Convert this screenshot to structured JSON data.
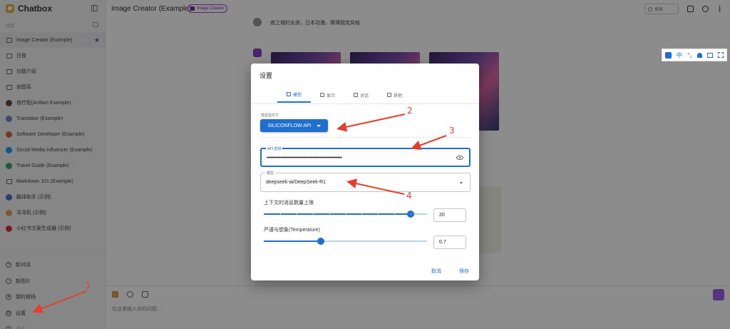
{
  "sidebar": {
    "app_name": "Chatbox",
    "section_title": "对话",
    "conversations": [
      {
        "label": "Image Creator (Example)",
        "icon": "chat-icon",
        "active": true,
        "starred": true
      },
      {
        "label": "日夜",
        "icon": "chat-icon"
      },
      {
        "label": "功能介绍",
        "icon": "chat-icon"
      },
      {
        "label": "创图系",
        "icon": "chat-icon"
      },
      {
        "label": "食疗配(Artifact Example)",
        "icon": "avatar",
        "color": "#6b4a3a"
      },
      {
        "label": "Translator (Example)",
        "icon": "avatar",
        "color": "#6f86c9"
      },
      {
        "label": "Software Developer (Example)",
        "icon": "avatar",
        "color": "#d36b3a"
      },
      {
        "label": "Social Media Influencer (Example)",
        "icon": "avatar",
        "color": "#1da1f2"
      },
      {
        "label": "Travel Guide (Example)",
        "icon": "avatar",
        "color": "#3fa06a"
      },
      {
        "label": "Markdown 101 (Example)",
        "icon": "chat-icon"
      },
      {
        "label": "翻译助手 (示例)",
        "icon": "avatar",
        "color": "#4a6fd1"
      },
      {
        "label": "寻寻机 (示例)",
        "icon": "avatar",
        "color": "#e0a34a"
      },
      {
        "label": "小红书文案生成器 (示例)",
        "icon": "avatar",
        "color": "#e02e3c"
      }
    ],
    "bottom": [
      {
        "label": "新对话",
        "icon": "plus-icon"
      },
      {
        "label": "新图片",
        "icon": "image-icon"
      },
      {
        "label": "我的搭档",
        "icon": "partner-icon"
      },
      {
        "label": "设置",
        "icon": "gear-icon"
      },
      {
        "label": "关于",
        "icon": "info-icon"
      }
    ]
  },
  "header": {
    "title": "Image Creator (Example)",
    "chip": "Image Creator",
    "search_placeholder": "搜索"
  },
  "chat": {
    "user_message": "夜之城的女孩，日本动漫，赛博朋克风格",
    "composer_placeholder": "在这里输入你的问题..."
  },
  "extension_toolbar": [
    "中",
    "°₂"
  ],
  "dialog": {
    "title": "设置",
    "tabs": [
      {
        "label": "模型",
        "icon": "model-icon",
        "active": true
      },
      {
        "label": "显示",
        "icon": "display-icon"
      },
      {
        "label": "对话",
        "icon": "chat-icon"
      },
      {
        "label": "其他",
        "icon": "gear-icon"
      }
    ],
    "provider_label": "模型提供方",
    "provider_value": "SILICONFLOW API",
    "api_key_label": "API 密钥",
    "api_key_value": "••••••••••••••••••••••••••••••••••••••••••••••••••••••",
    "model_label": "模型",
    "model_value": "deepseek-ai/DeepSeek-R1",
    "context_label": "上下文的消息数量上限",
    "context_value": "20",
    "context_fraction": 0.9,
    "temperature_label": "严谨与想象(Temperature)",
    "temperature_value": "0.7",
    "temperature_fraction": 0.35,
    "cancel_label": "取消",
    "save_label": "保存"
  },
  "annotations": {
    "color": "#e53e2f",
    "labels": [
      "1",
      "2",
      "3",
      "4"
    ]
  }
}
